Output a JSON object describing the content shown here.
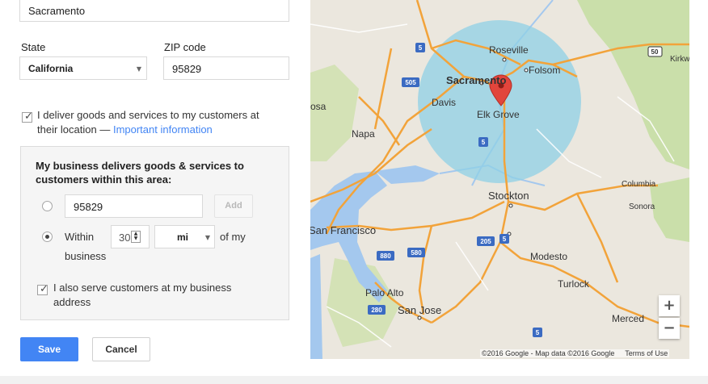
{
  "form": {
    "city_value": "Sacramento",
    "state_label": "State",
    "state_value": "California",
    "zip_label": "ZIP code",
    "zip_value": "95829",
    "deliver_checkbox_text": "I deliver goods and services to my customers at their location —",
    "deliver_checked": true,
    "important_info_link": "Important information"
  },
  "service_area": {
    "heading": "My business delivers goods & services to customers within this area:",
    "zip_input_value": "95829",
    "add_button": "Add",
    "within_label": "Within",
    "radius_value": "30",
    "unit_value": "mi",
    "of_my_business": "of my",
    "business_word": "business",
    "also_serve_text": "I also serve customers at my business address",
    "also_serve_checked": true
  },
  "actions": {
    "save": "Save",
    "cancel": "Cancel"
  },
  "colors": {
    "accent": "#4285f4",
    "link": "#4285f4",
    "area_circle": "#8fd0e6"
  },
  "map": {
    "places": {
      "roseville": "Roseville",
      "sacramento": "Sacramento",
      "folsom": "Folsom",
      "davis": "Davis",
      "elk_grove": "Elk Grove",
      "napa": "Napa",
      "stockton": "Stockton",
      "san_francisco": "San Francisco",
      "modesto": "Modesto",
      "turlock": "Turlock",
      "palo_alto": "Palo Alto",
      "san_jose": "San Jose",
      "merced": "Merced",
      "columbia": "Columbia",
      "sonora": "Sonora",
      "kirkwood": "Kirkw",
      "rosa": "osa"
    },
    "shields": {
      "i5_north": "5",
      "i505": "505",
      "i5_south": "5",
      "i205": "205",
      "i5_mid": "5",
      "i880": "880",
      "i580": "580",
      "i280": "280",
      "i5_bottom": "5",
      "r50": "50"
    },
    "zoom_in": "+",
    "zoom_out": "−",
    "attribution": "©2016 Google - Map data ©2016 Google",
    "terms": "Terms of Use"
  }
}
